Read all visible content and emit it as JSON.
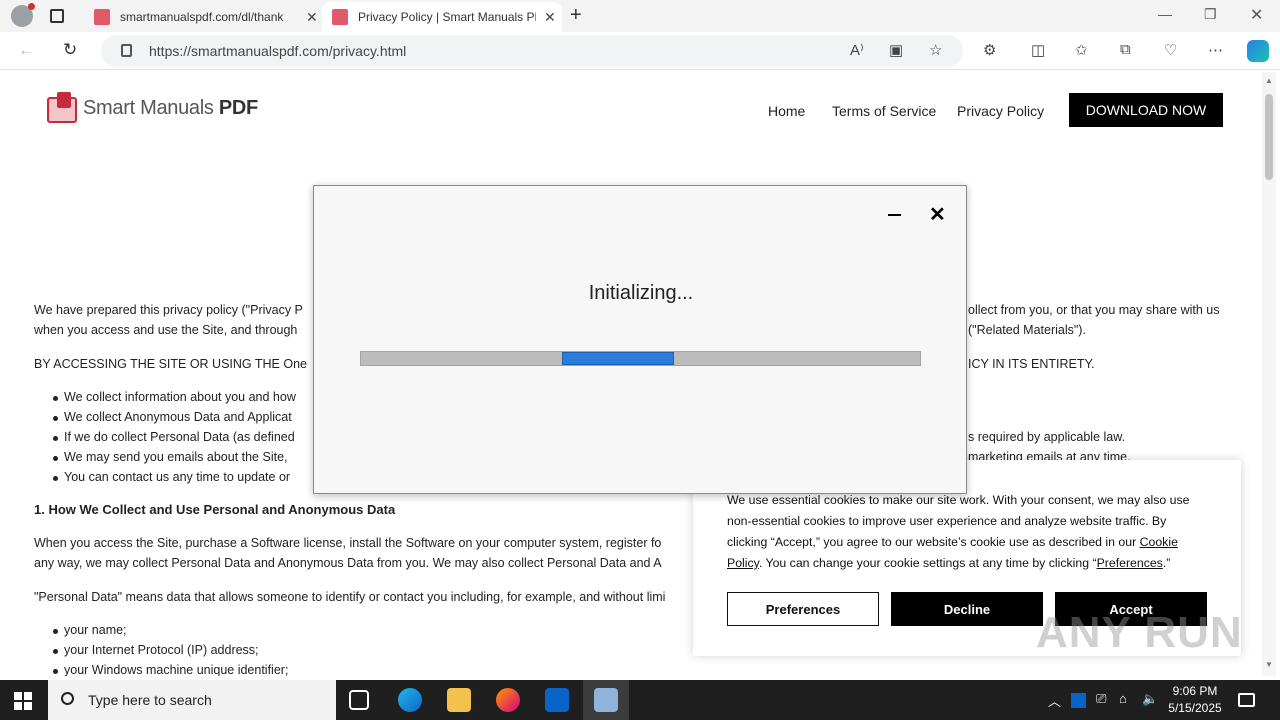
{
  "browser": {
    "tabs": [
      {
        "title": "smartmanualspdf.com/dl/thank"
      },
      {
        "title": "Privacy Policy | Smart Manuals PDF"
      }
    ],
    "url": "https://smartmanualspdf.com/privacy.html"
  },
  "site": {
    "logo_part1": "Smart Manuals ",
    "logo_part2": "PDF",
    "nav": [
      "Home",
      "Terms of Service",
      "Privacy Policy"
    ],
    "download_label": "DOWNLOAD NOW"
  },
  "content": {
    "intro_line1_left": "We have prepared this privacy policy (\"Privacy P",
    "intro_line1_right": "ollect from you, or that you may share with us",
    "intro_line2_left": "when you access and use the Site, and through",
    "intro_line2_right": "(\"Related Materials\").",
    "caps_left": "BY ACCESSING THE SITE OR USING THE One",
    "caps_right": "ICY IN ITS ENTIRETY.",
    "bullets": [
      {
        "left": "We collect information about you and how",
        "right": ""
      },
      {
        "left": "We collect Anonymous Data and Applicat",
        "right": ""
      },
      {
        "left": "If we do collect Personal Data (as defined",
        "right": "s required by applicable law."
      },
      {
        "left": "We may send you emails about the Site,",
        "right": "marketing emails at any time."
      },
      {
        "left": "You can contact us any time to update or",
        "right": ""
      }
    ],
    "heading1": "1. How We Collect and Use Personal and Anonymous Data",
    "p1_line1": "When you access the Site, purchase a Software license, install the Software on your computer system, register fo",
    "p1_line2": "any way, we may collect Personal Data and Anonymous Data from you. We may also collect Personal Data and A",
    "p2_line1": "\"Personal Data\" means data that allows someone to identify or contact you including, for example, and without limi",
    "list2": [
      "your name;",
      "your Internet Protocol (IP) address;",
      "your Windows machine unique identifier;"
    ]
  },
  "dialog": {
    "status": "Initializing...",
    "progress_start": 0.36,
    "progress_end": 0.56
  },
  "cookie": {
    "text_before_link": "We use essential cookies to make our site work. With your consent, we may also use non-essential cookies to improve user experience and analyze website traffic. By clicking “Accept,” you agree to our website’s cookie use as described in our ",
    "cookie_policy_link": "Cookie Policy",
    "text_middle": ". You can change your cookie settings at any time by clicking “",
    "preferences_link": "Preferences",
    "text_end": ".”",
    "preferences_label": "Preferences",
    "decline_label": "Decline",
    "accept_label": "Accept"
  },
  "watermark": "ANY RUN",
  "taskbar": {
    "search_placeholder": "Type here to search",
    "time": "9:06 PM",
    "date": "5/15/2025"
  }
}
